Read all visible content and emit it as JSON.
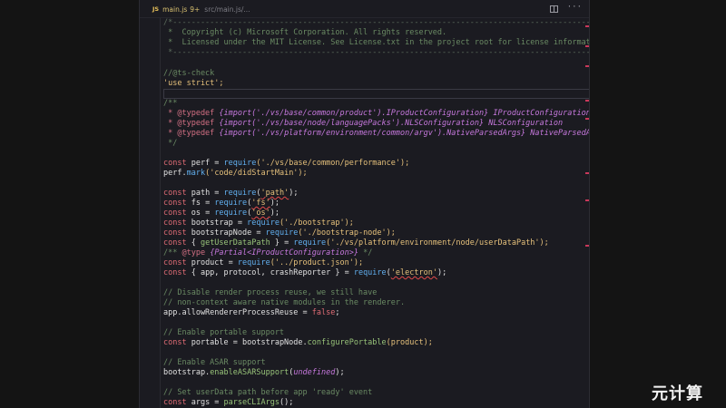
{
  "tab": {
    "lang_icon": "JS",
    "filename": "main.js",
    "badge": "9+",
    "path": "src/main.js/..."
  },
  "actions": {
    "split_icon": "split-editor-icon",
    "more_icon": "ellipsis-icon",
    "more_glyph": "···"
  },
  "code": {
    "l1": "/*---------------------------------------------------------------------------------------------",
    "l2": " *  Copyright (c) Microsoft Corporation. All rights reserved.",
    "l3": " *  Licensed under the MIT License. See License.txt in the project root for license information.",
    "l4": " *--------------------------------------------------------------------------------------------*/",
    "l5": "//@ts-check",
    "l6": "'use strict';",
    "l7": "/**",
    "l8a": " * @typedef ",
    "l8b": "{import('./vs/base/common/product').IProductConfiguration}",
    "l8c": " IProductConfiguration",
    "l9a": " * @typedef ",
    "l9b": "{import('./vs/base/node/languagePacks').NLSConfiguration}",
    "l9c": " NLSConfiguration",
    "l10a": " * @typedef ",
    "l10b": "{import('./vs/platform/environment/common/argv').NativeParsedArgs}",
    "l10c": " NativeParsedArgs",
    "l11": " */",
    "l12a": "const",
    "l12b": " perf = ",
    "l12c": "require",
    "l12d": "('./vs/base/common/performance');",
    "l13a": "perf.",
    "l13b": "mark",
    "l13c": "('code/didStartMain');",
    "l14a": "const",
    "l14b": " path = ",
    "l14c": "require",
    "l14d": "(",
    "l14e": "'path'",
    "l14f": ");",
    "l15a": "const",
    "l15b": " fs = ",
    "l15c": "require",
    "l15d": "(",
    "l15e": "'fs'",
    "l15f": ");",
    "l16a": "const",
    "l16b": " os = ",
    "l16c": "require",
    "l16d": "(",
    "l16e": "'os'",
    "l16f": ");",
    "l17a": "const",
    "l17b": " bootstrap = ",
    "l17c": "require",
    "l17d": "('./bootstrap');",
    "l18a": "const",
    "l18b": " bootstrapNode = ",
    "l18c": "require",
    "l18d": "('./bootstrap-node');",
    "l19a": "const",
    "l19b": " { ",
    "l19c": "getUserDataPath",
    "l19d": " } = ",
    "l19e": "require",
    "l19f": "('./vs/platform/environment/node/userDataPath');",
    "l20a": "/** ",
    "l20b": "@type",
    "l20c": " {Partial<IProductConfiguration>}",
    "l20d": " */",
    "l21a": "const",
    "l21b": " product = ",
    "l21c": "require",
    "l21d": "('../product.json');",
    "l22a": "const",
    "l22b": " { app, protocol, crashReporter } = ",
    "l22c": "require",
    "l22d": "(",
    "l22e": "'electron'",
    "l22f": ");",
    "l23": "// Disable render process reuse, we still have",
    "l24": "// non-context aware native modules in the renderer.",
    "l25a": "app.allowRendererProcessReuse = ",
    "l25b": "false",
    "l25c": ";",
    "l26": "// Enable portable support",
    "l27a": "const",
    "l27b": " portable = bootstrapNode.",
    "l27c": "configurePortable",
    "l27d": "(product);",
    "l28": "// Enable ASAR support",
    "l29a": "bootstrap.",
    "l29b": "enableASARSupport",
    "l29c": "(",
    "l29d": "undefined",
    "l29e": ");",
    "l30": "// Set userData path before app 'ready' event",
    "l31a": "const",
    "l31b": " args = ",
    "l31c": "parseCLIArgs",
    "l31d": "();"
  },
  "watermark": "元计算"
}
